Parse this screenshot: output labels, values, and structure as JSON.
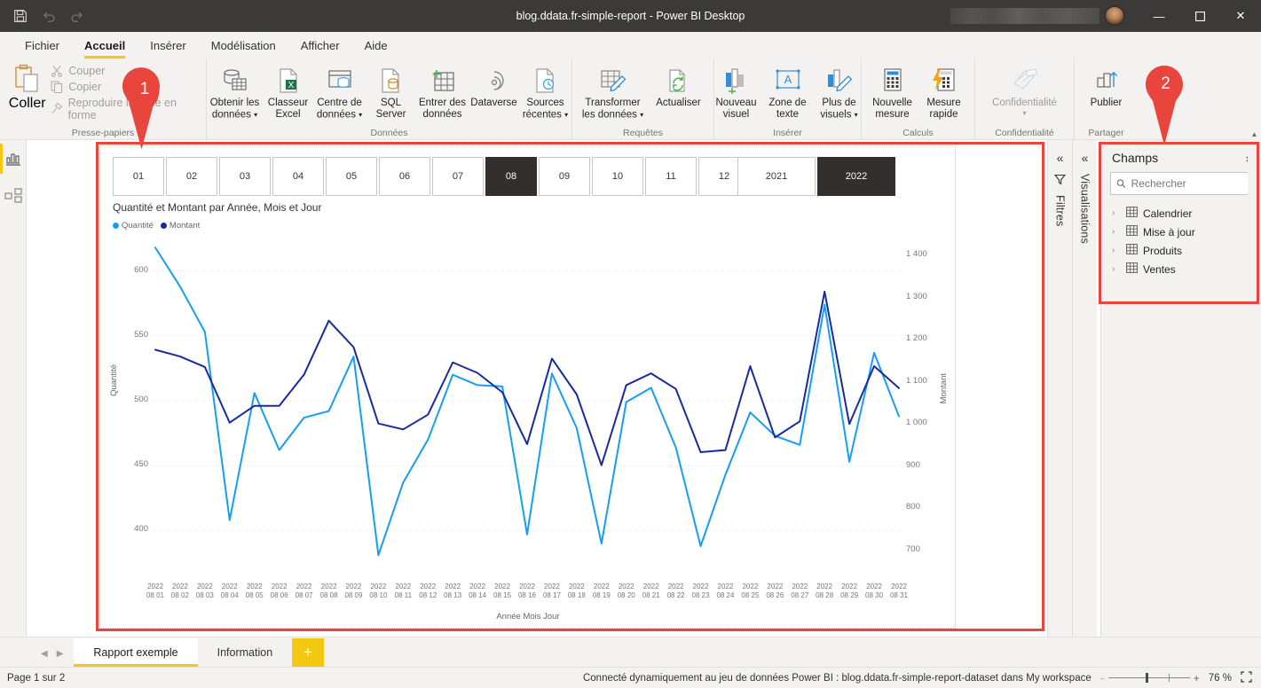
{
  "titlebar": {
    "document_title": "blog.ddata.fr-simple-report - Power BI Desktop",
    "save_icon": "save-icon",
    "undo_icon": "undo-icon",
    "redo_icon": "redo-icon",
    "minimize_label": "—",
    "maximize_label": "☐",
    "close_label": "✕"
  },
  "menu": {
    "items": [
      {
        "label": "Fichier",
        "active": false
      },
      {
        "label": "Accueil",
        "active": true
      },
      {
        "label": "Insérer",
        "active": false
      },
      {
        "label": "Modélisation",
        "active": false
      },
      {
        "label": "Afficher",
        "active": false
      },
      {
        "label": "Aide",
        "active": false
      }
    ]
  },
  "ribbon": {
    "groups": [
      {
        "name": "Presse-papiers",
        "label": "Presse-papiers",
        "paste": "Coller",
        "cut": "Couper",
        "copy": "Copier",
        "format_painter": "Reproduire la mise en forme"
      },
      {
        "name": "Données",
        "label": "Données",
        "items": [
          {
            "label": "Obtenir les données",
            "chevron": true
          },
          {
            "label": "Classeur Excel",
            "chevron": false
          },
          {
            "label": "Centre de données",
            "chevron": true
          },
          {
            "label": "SQL Server",
            "chevron": false
          },
          {
            "label": "Entrer des données",
            "chevron": false
          },
          {
            "label": "Dataverse",
            "chevron": false
          },
          {
            "label": "Sources récentes",
            "chevron": true
          }
        ]
      },
      {
        "name": "Requêtes",
        "label": "Requêtes",
        "items": [
          {
            "label": "Transformer les données",
            "chevron": true
          },
          {
            "label": "Actualiser",
            "chevron": false
          }
        ]
      },
      {
        "name": "Insérer",
        "label": "Insérer",
        "items": [
          {
            "label": "Nouveau visuel",
            "chevron": false
          },
          {
            "label": "Zone de texte",
            "chevron": false
          },
          {
            "label": "Plus de visuels",
            "chevron": true
          }
        ]
      },
      {
        "name": "Calculs",
        "label": "Calculs",
        "items": [
          {
            "label": "Nouvelle mesure",
            "chevron": false
          },
          {
            "label": "Mesure rapide",
            "chevron": false
          }
        ]
      },
      {
        "name": "Confidentialité",
        "label": "Confidentialité",
        "items": [
          {
            "label": "Confidentialité",
            "chevron": true
          }
        ]
      },
      {
        "name": "Partager",
        "label": "Partager",
        "items": [
          {
            "label": "Publier",
            "chevron": false
          }
        ]
      }
    ]
  },
  "left_rail": {
    "items": [
      {
        "name": "report-view",
        "active": true
      },
      {
        "name": "model-view",
        "active": false
      }
    ]
  },
  "report": {
    "month_slicer": {
      "values": [
        "01",
        "02",
        "03",
        "04",
        "05",
        "06",
        "07",
        "08",
        "09",
        "10",
        "11",
        "12"
      ],
      "selected": "08"
    },
    "year_slicer": {
      "values": [
        "2021",
        "2022"
      ],
      "selected": "2022"
    }
  },
  "side_rails": {
    "filters_label": "Filtres",
    "visualisations_label": "Visualisations",
    "collapse_icon": "chevron-double-left-icon",
    "filter_icon": "filter-icon"
  },
  "fields_pane": {
    "title": "Champs",
    "expand_icon": "chevron-double-right-icon",
    "search_placeholder": "Rechercher",
    "search_value": "",
    "search_icon": "search-icon",
    "tables": [
      {
        "label": "Calendrier"
      },
      {
        "label": "Mise à jour"
      },
      {
        "label": "Produits"
      },
      {
        "label": "Ventes"
      }
    ]
  },
  "page_tabs": {
    "tabs": [
      {
        "label": "Rapport exemple",
        "active": true
      },
      {
        "label": "Information",
        "active": false
      }
    ],
    "add_label": "+"
  },
  "statusbar": {
    "page_indicator": "Page 1 sur 2",
    "connection": "Connecté dynamiquement au jeu de données Power BI : blog.ddata.fr-simple-report-dataset dans My workspace",
    "zoom_minus": "–",
    "zoom_plus": "+",
    "zoom_level": "76 %",
    "fit_icon": "fit-to-page-icon"
  },
  "annotations": {
    "pins": [
      {
        "number": "1",
        "color": "#e8463c"
      },
      {
        "number": "2",
        "color": "#e8463c"
      }
    ],
    "highlight_color": "#e8463c"
  },
  "chart_data": {
    "type": "line",
    "title": "Quantité et Montant par Année, Mois et Jour",
    "xlabel": "Année Mois Jour",
    "ylabel": "Quantité",
    "y2label": "Montant",
    "grid": true,
    "legend_position": "top-left",
    "ylim": [
      375,
      625
    ],
    "yticks": [
      400,
      450,
      500,
      550,
      600
    ],
    "y2lim": [
      670,
      1440
    ],
    "y2ticks": [
      "700",
      "800",
      "900",
      "1 000",
      "1 100",
      "1 200",
      "1 300",
      "1 400"
    ],
    "categories": [
      "2022 08 01",
      "2022 08 02",
      "2022 08 03",
      "2022 08 04",
      "2022 08 05",
      "2022 08 06",
      "2022 08 07",
      "2022 08 08",
      "2022 08 09",
      "2022 08 10",
      "2022 08 11",
      "2022 08 12",
      "2022 08 13",
      "2022 08 14",
      "2022 08 15",
      "2022 08 16",
      "2022 08 17",
      "2022 08 18",
      "2022 08 19",
      "2022 08 20",
      "2022 08 21",
      "2022 08 22",
      "2022 08 23",
      "2022 08 24",
      "2022 08 25",
      "2022 08 26",
      "2022 08 27",
      "2022 08 28",
      "2022 08 29",
      "2022 08 30",
      "2022 08 31"
    ],
    "series": [
      {
        "name": "Quantité",
        "color": "#169ef0",
        "axis": "left",
        "values": [
          618,
          588,
          553,
          408,
          506,
          462,
          487,
          492,
          534,
          381,
          437,
          470,
          520,
          512,
          511,
          397,
          521,
          479,
          390,
          499,
          510,
          464,
          388,
          443,
          491,
          473,
          466,
          574,
          453,
          537,
          488
        ]
      },
      {
        "name": "Montant",
        "color": "#1a2a9c",
        "axis": "right",
        "values": [
          1176,
          1160,
          1135,
          1003,
          1043,
          1043,
          1117,
          1245,
          1182,
          1001,
          987,
          1022,
          1146,
          1121,
          1075,
          952,
          1155,
          1070,
          902,
          1092,
          1120,
          1083,
          933,
          938,
          1137,
          968,
          1006,
          1314,
          1000,
          1137,
          1085
        ]
      }
    ]
  }
}
